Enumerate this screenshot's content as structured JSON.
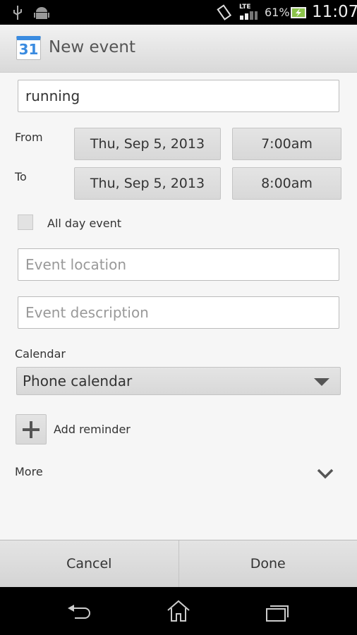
{
  "status_bar": {
    "battery": "61%",
    "time": "11:07",
    "network": "LTE",
    "icons": [
      "usb-icon",
      "android-icon",
      "vibrate-icon",
      "signal-icon",
      "battery-charging-icon"
    ]
  },
  "action_bar": {
    "app_icon_text": "31",
    "title": "New event"
  },
  "form": {
    "title_value": "running",
    "from_label": "From",
    "from_date": "Thu, Sep 5, 2013",
    "from_time": "7:00am",
    "to_label": "To",
    "to_date": "Thu, Sep 5, 2013",
    "to_time": "8:00am",
    "all_day_label": "All day event",
    "all_day_checked": false,
    "location_placeholder": "Event location",
    "description_placeholder": "Event description",
    "calendar_label": "Calendar",
    "calendar_value": "Phone calendar",
    "add_reminder_label": "Add reminder",
    "more_label": "More"
  },
  "bottom": {
    "cancel": "Cancel",
    "done": "Done"
  },
  "nav": {
    "icons": [
      "back-icon",
      "home-icon",
      "recent-apps-icon"
    ]
  },
  "colors": {
    "calendar_blue": "#3a8be0",
    "battery_green": "#8bc34a"
  }
}
